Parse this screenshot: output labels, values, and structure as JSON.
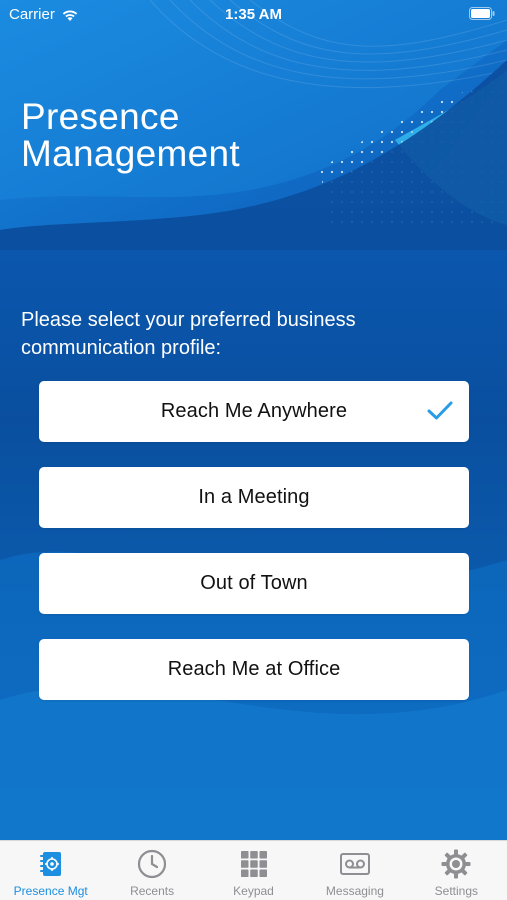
{
  "status_bar": {
    "carrier": "Carrier",
    "time": "1:35 AM"
  },
  "header": {
    "title_line1": "Presence",
    "title_line2": "Management"
  },
  "prompt": {
    "line1": "Please select your preferred business",
    "line2": "communication profile:"
  },
  "profiles": [
    {
      "label": "Reach Me Anywhere",
      "selected": true
    },
    {
      "label": "In a Meeting",
      "selected": false
    },
    {
      "label": "Out of Town",
      "selected": false
    },
    {
      "label": "Reach Me at Office",
      "selected": false
    }
  ],
  "tabs": [
    {
      "label": "Presence Mgt",
      "icon": "presence-icon",
      "active": true
    },
    {
      "label": "Recents",
      "icon": "clock-icon",
      "active": false
    },
    {
      "label": "Keypad",
      "icon": "keypad-icon",
      "active": false
    },
    {
      "label": "Messaging",
      "icon": "voicemail-icon",
      "active": false
    },
    {
      "label": "Settings",
      "icon": "gear-icon",
      "active": false
    }
  ],
  "colors": {
    "accent": "#1c8fe0",
    "background_deep": "#0b4fa0",
    "background_light": "#1a7fd6",
    "check": "#2a9be6",
    "tab_inactive": "#8e8e93"
  }
}
